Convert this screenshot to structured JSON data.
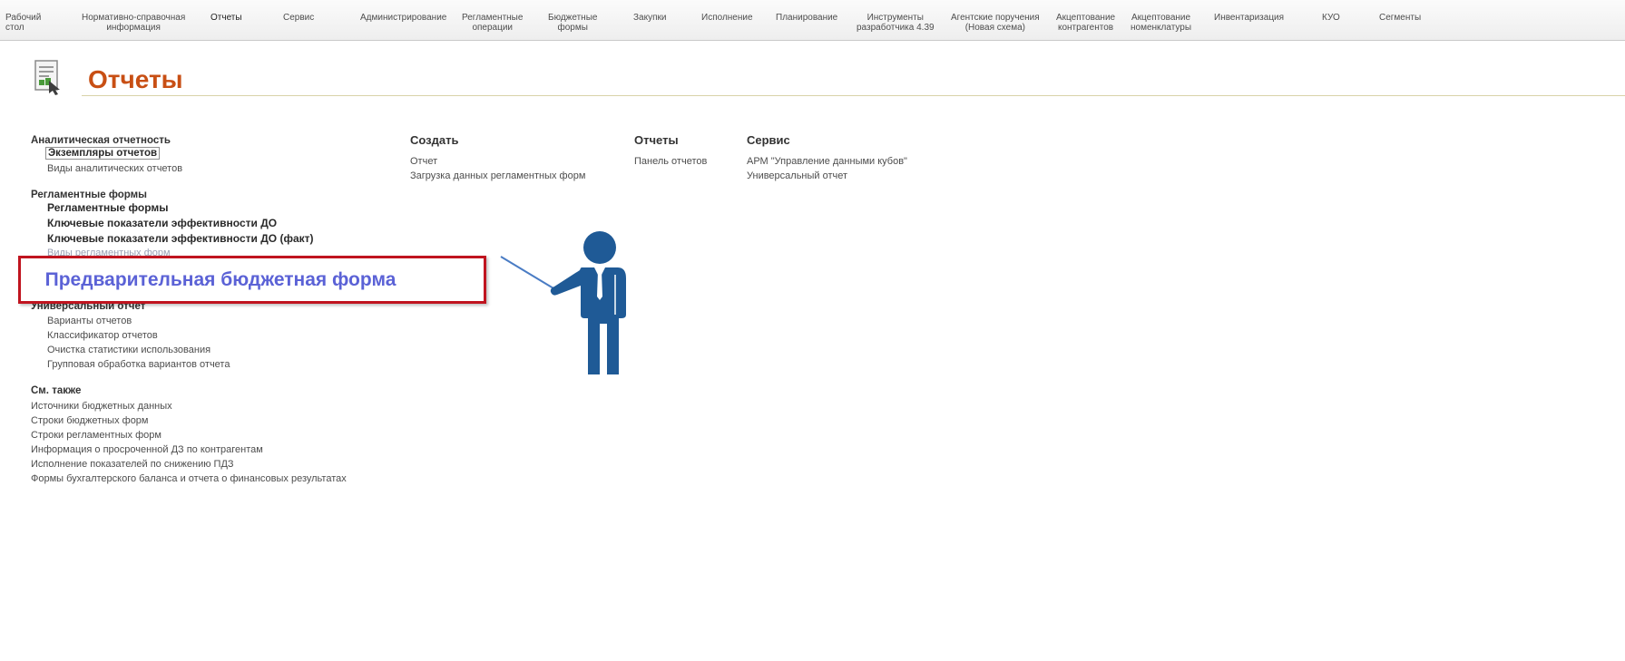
{
  "nav": {
    "items": [
      "Рабочий\nстол",
      "Нормативно-справочная\nинформация",
      "Отчеты",
      "Сервис",
      "Администрирование",
      "Регламентные\nоперации",
      "Бюджетные\nформы",
      "Закупки",
      "Исполнение",
      "Планирование",
      "Инструменты\nразработчика 4.39",
      "Агентские поручения\n(Новая схема)",
      "Акцептование\nконтрагентов",
      "Акцептование\nноменклатуры",
      "Инвентаризация",
      "КУО",
      "Сегменты"
    ],
    "active_index": 2
  },
  "page": {
    "title": "Отчеты"
  },
  "analytic": {
    "header": "Аналитическая отчетность",
    "links": [
      "Экземпляры отчетов",
      "Виды аналитических отчетов"
    ]
  },
  "reglament": {
    "header": "Регламентные формы",
    "links": [
      "Регламентные формы",
      "Ключевые показатели эффективности ДО",
      "Ключевые показатели эффективности ДО (факт)",
      "Виды регламентных форм"
    ]
  },
  "universal": {
    "header": "Универсальный отчет",
    "links": [
      "Варианты отчетов",
      "Классификатор отчетов",
      "Очистка статистики использования",
      "Групповая обработка вариантов отчета"
    ]
  },
  "see_also": {
    "header": "См. также",
    "links": [
      "Источники бюджетных данных",
      "Строки бюджетных форм",
      "Строки регламентных форм",
      "Информация о просроченной ДЗ по контрагентам",
      "Исполнение показателей по снижению ПДЗ",
      "Формы бухгалтерского баланса и отчета о финансовых результатах"
    ]
  },
  "create": {
    "header": "Создать",
    "links": [
      "Отчет",
      "Загрузка данных регламентных форм"
    ]
  },
  "reports": {
    "header": "Отчеты",
    "links": [
      "Панель отчетов"
    ]
  },
  "service": {
    "header": "Сервис",
    "links": [
      "АРМ \"Управление данными кубов\"",
      "Универсальный отчет"
    ]
  },
  "callout": {
    "text": "Предварительная бюджетная форма"
  },
  "colors": {
    "title": "#c84f14",
    "callout_border": "#c0141f",
    "callout_text": "#5b62d6",
    "figure": "#1f5a96"
  }
}
